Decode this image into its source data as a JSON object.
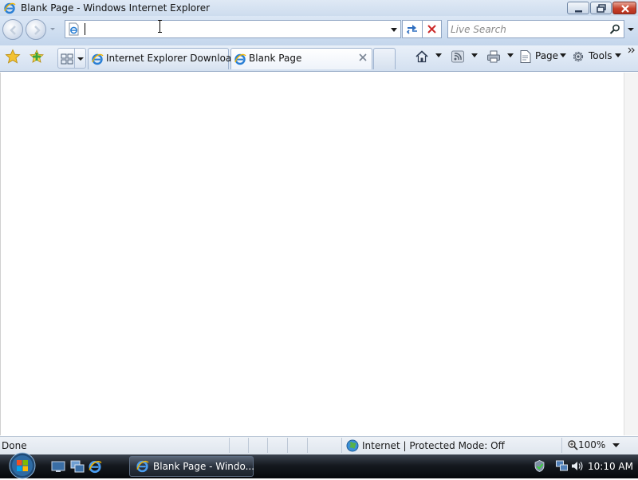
{
  "window": {
    "title": "Blank Page - Windows Internet Explorer"
  },
  "address_bar": {
    "value": "",
    "search_placeholder": "Live Search"
  },
  "tabs": [
    {
      "label": "Internet Explorer Downloa..."
    },
    {
      "label": "Blank Page"
    }
  ],
  "command_bar": {
    "page_label": "Page",
    "tools_label": "Tools"
  },
  "status_bar": {
    "status": "Done",
    "zone": "Internet | Protected Mode: Off",
    "zoom": "100%"
  },
  "taskbar": {
    "active_window_label": "Blank Page - Windo...",
    "clock": "10:10 AM"
  },
  "icons": {
    "app": "internet-explorer-icon",
    "favorites": "star-icon",
    "add_favorite": "add-star-icon",
    "home": "home-icon",
    "feeds": "rss-icon",
    "print": "printer-icon",
    "tools": "gear-icon"
  },
  "colors": {
    "chrome_blue": "#cddcee",
    "close_red": "#c6402b",
    "taskbar_dark": "#15191f"
  }
}
